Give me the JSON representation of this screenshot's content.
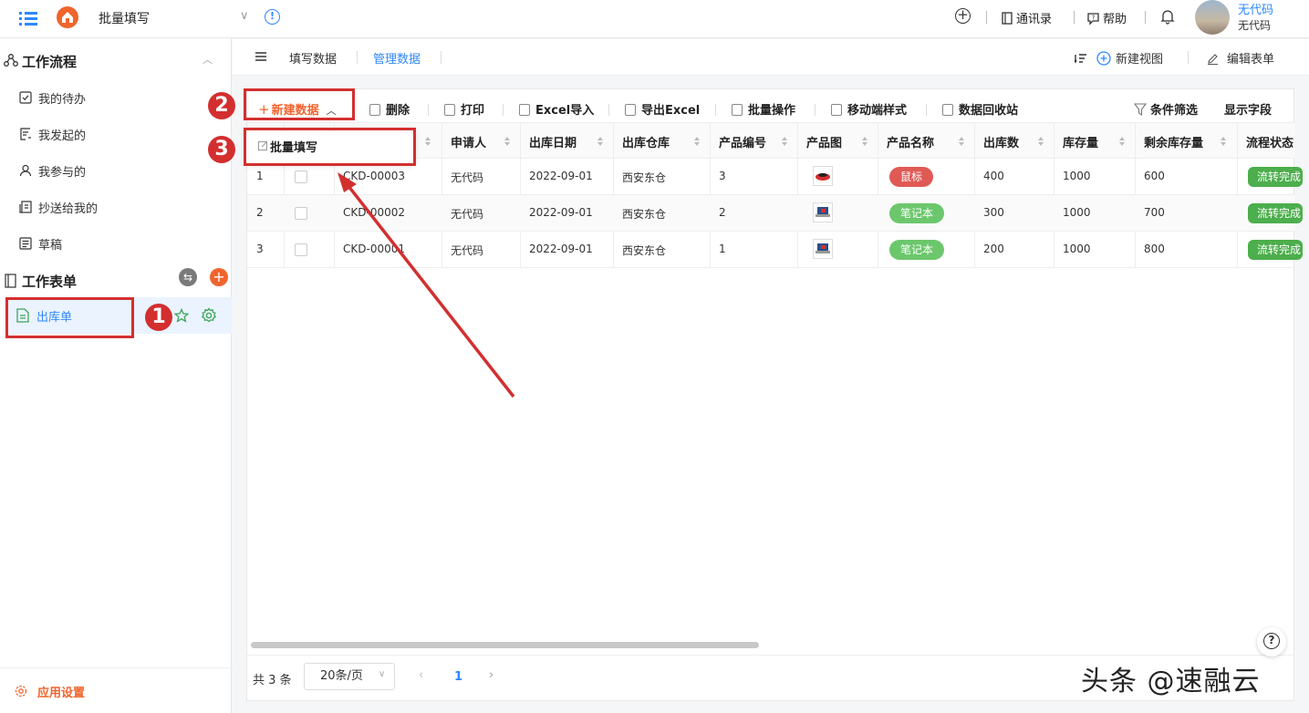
{
  "header": {
    "app_title": "批量填写",
    "contacts": "通讯录",
    "help": "帮助",
    "user_name": "无代码",
    "user_org": "无代码"
  },
  "sidebar": {
    "workflow_title": "工作流程",
    "workflow_items": [
      {
        "label": "我的待办",
        "icon": "todo-icon"
      },
      {
        "label": "我发起的",
        "icon": "initiated-icon"
      },
      {
        "label": "我参与的",
        "icon": "participated-icon"
      },
      {
        "label": "抄送给我的",
        "icon": "cc-icon"
      },
      {
        "label": "草稿",
        "icon": "draft-icon"
      }
    ],
    "forms_title": "工作表单",
    "active_form": "出库单",
    "settings": "应用设置"
  },
  "tabs": {
    "fill": "填写数据",
    "manage": "管理数据",
    "new_view": "新建视图",
    "edit_form": "编辑表单"
  },
  "toolbar": {
    "new_data": "新建数据",
    "delete": "删除",
    "print": "打印",
    "excel_import": "Excel导入",
    "export_excel": "导出Excel",
    "batch_ops": "批量操作",
    "mobile_style": "移动端样式",
    "recycle": "数据回收站",
    "filter": "条件筛选",
    "show_fields": "显示字段"
  },
  "dropdown": {
    "batch_fill": "批量填写"
  },
  "table": {
    "columns": [
      "申请人",
      "出库日期",
      "出库仓库",
      "产品编号",
      "产品图",
      "产品名称",
      "出库数",
      "库存量",
      "剩余库存量",
      "流程状态"
    ],
    "rows": [
      {
        "index": "1",
        "code": "CKD-00003",
        "applicant": "无代码",
        "date": "2022-09-01",
        "warehouse": "西安东仓",
        "product_no": "3",
        "product_name": "鼠标",
        "out_qty": "400",
        "stock": "1000",
        "remaining": "600",
        "status": "流转完成"
      },
      {
        "index": "2",
        "code": "CKD-00002",
        "applicant": "无代码",
        "date": "2022-09-01",
        "warehouse": "西安东仓",
        "product_no": "2",
        "product_name": "笔记本",
        "out_qty": "300",
        "stock": "1000",
        "remaining": "700",
        "status": "流转完成"
      },
      {
        "index": "3",
        "code": "CKD-00001",
        "applicant": "无代码",
        "date": "2022-09-01",
        "warehouse": "西安东仓",
        "product_no": "1",
        "product_name": "笔记本",
        "out_qty": "200",
        "stock": "1000",
        "remaining": "800",
        "status": "流转完成"
      }
    ]
  },
  "pager": {
    "total": "共 3 条",
    "page_size": "20条/页",
    "current_page": "1"
  },
  "annotations": {
    "n1": "1",
    "n2": "2",
    "n3": "3"
  },
  "watermark": "头条 @速融云",
  "colors": {
    "accent": "#2f88ff",
    "brand": "#f0642d",
    "annotation": "#d32f2f",
    "tag_red": "#e05a55",
    "tag_green": "#6cc76c",
    "status_green": "#4cae4c"
  }
}
